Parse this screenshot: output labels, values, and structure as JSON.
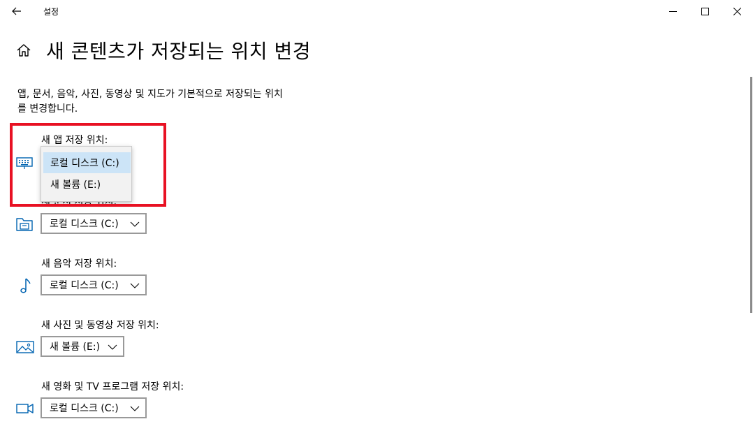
{
  "window": {
    "app_name": "설정",
    "back_icon": "back-arrow-icon",
    "minimize_icon": "minimize-icon",
    "maximize_icon": "maximize-icon",
    "close_icon": "close-icon"
  },
  "header": {
    "home_icon": "home-icon",
    "title": "새 콘텐츠가 저장되는 위치 변경"
  },
  "description": {
    "line1": "앱, 문서, 음악, 사진, 동영상 및 지도가 기본적으로 저장되는 위치",
    "line2": "를 변경합니다."
  },
  "sections": [
    {
      "label": "새 앱 저장 위치:",
      "icon": "keyboard-icon",
      "value": "로컬 디스크 (C:)"
    },
    {
      "label": "새 문서 저장 위치:",
      "icon": "folder-icon",
      "value": "로컬 디스크 (C:)"
    },
    {
      "label": "새 음악 저장 위치:",
      "icon": "music-note-icon",
      "value": "로컬 디스크 (C:)"
    },
    {
      "label": "새 사진 및 동영상 저장 위치:",
      "icon": "picture-icon",
      "value": "새 볼륨 (E:)"
    },
    {
      "label": "새 영화 및 TV 프로그램 저장 위치:",
      "icon": "video-camera-icon",
      "value": "로컬 디스크 (C:)"
    }
  ],
  "dropdown": {
    "options": [
      "로컬 디스크 (C:)",
      "새 볼륨 (E:)"
    ],
    "selected": "로컬 디스크 (C:)"
  },
  "colors": {
    "accent_icon": "#0063b1",
    "highlight_box": "#e81123",
    "dropdown_selected": "#cce4f7"
  }
}
